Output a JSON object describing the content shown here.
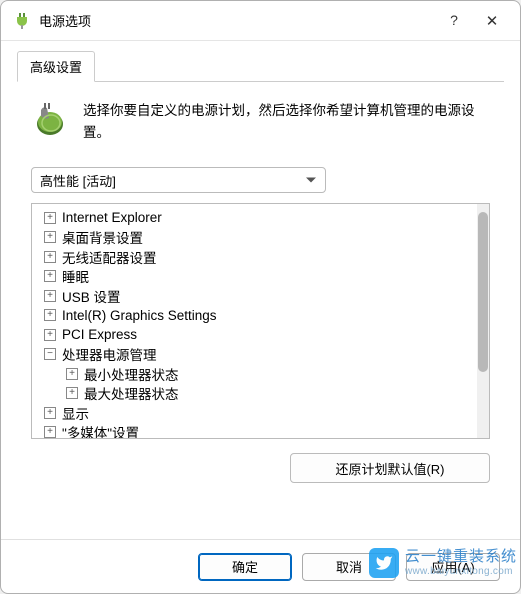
{
  "window": {
    "title": "电源选项",
    "help_symbol": "?",
    "close_symbol": "✕"
  },
  "tabs": [
    {
      "label": "高级设置"
    }
  ],
  "intro_text": "选择你要自定义的电源计划，然后选择你希望计算机管理的电源设置。",
  "plan_dropdown": {
    "selected": "高性能 [活动]"
  },
  "tree": {
    "items": [
      {
        "label": "Internet Explorer",
        "glyph": "+",
        "depth": 0
      },
      {
        "label": "桌面背景设置",
        "glyph": "+",
        "depth": 0
      },
      {
        "label": "无线适配器设置",
        "glyph": "+",
        "depth": 0
      },
      {
        "label": "睡眠",
        "glyph": "+",
        "depth": 0
      },
      {
        "label": "USB 设置",
        "glyph": "+",
        "depth": 0
      },
      {
        "label": "Intel(R) Graphics Settings",
        "glyph": "+",
        "depth": 0
      },
      {
        "label": "PCI Express",
        "glyph": "+",
        "depth": 0
      },
      {
        "label": "处理器电源管理",
        "glyph": "−",
        "depth": 0
      },
      {
        "label": "最小处理器状态",
        "glyph": "+",
        "depth": 1
      },
      {
        "label": "最大处理器状态",
        "glyph": "+",
        "depth": 1
      },
      {
        "label": "显示",
        "glyph": "+",
        "depth": 0
      },
      {
        "label": "\"多媒体\"设置",
        "glyph": "+",
        "depth": 0
      }
    ]
  },
  "buttons": {
    "restore_defaults": "还原计划默认值(R)",
    "ok": "确定",
    "cancel": "取消",
    "apply": "应用(A)"
  },
  "watermark": {
    "cn": "云一键重装系统",
    "url": "www.baiyunxitong.com"
  }
}
